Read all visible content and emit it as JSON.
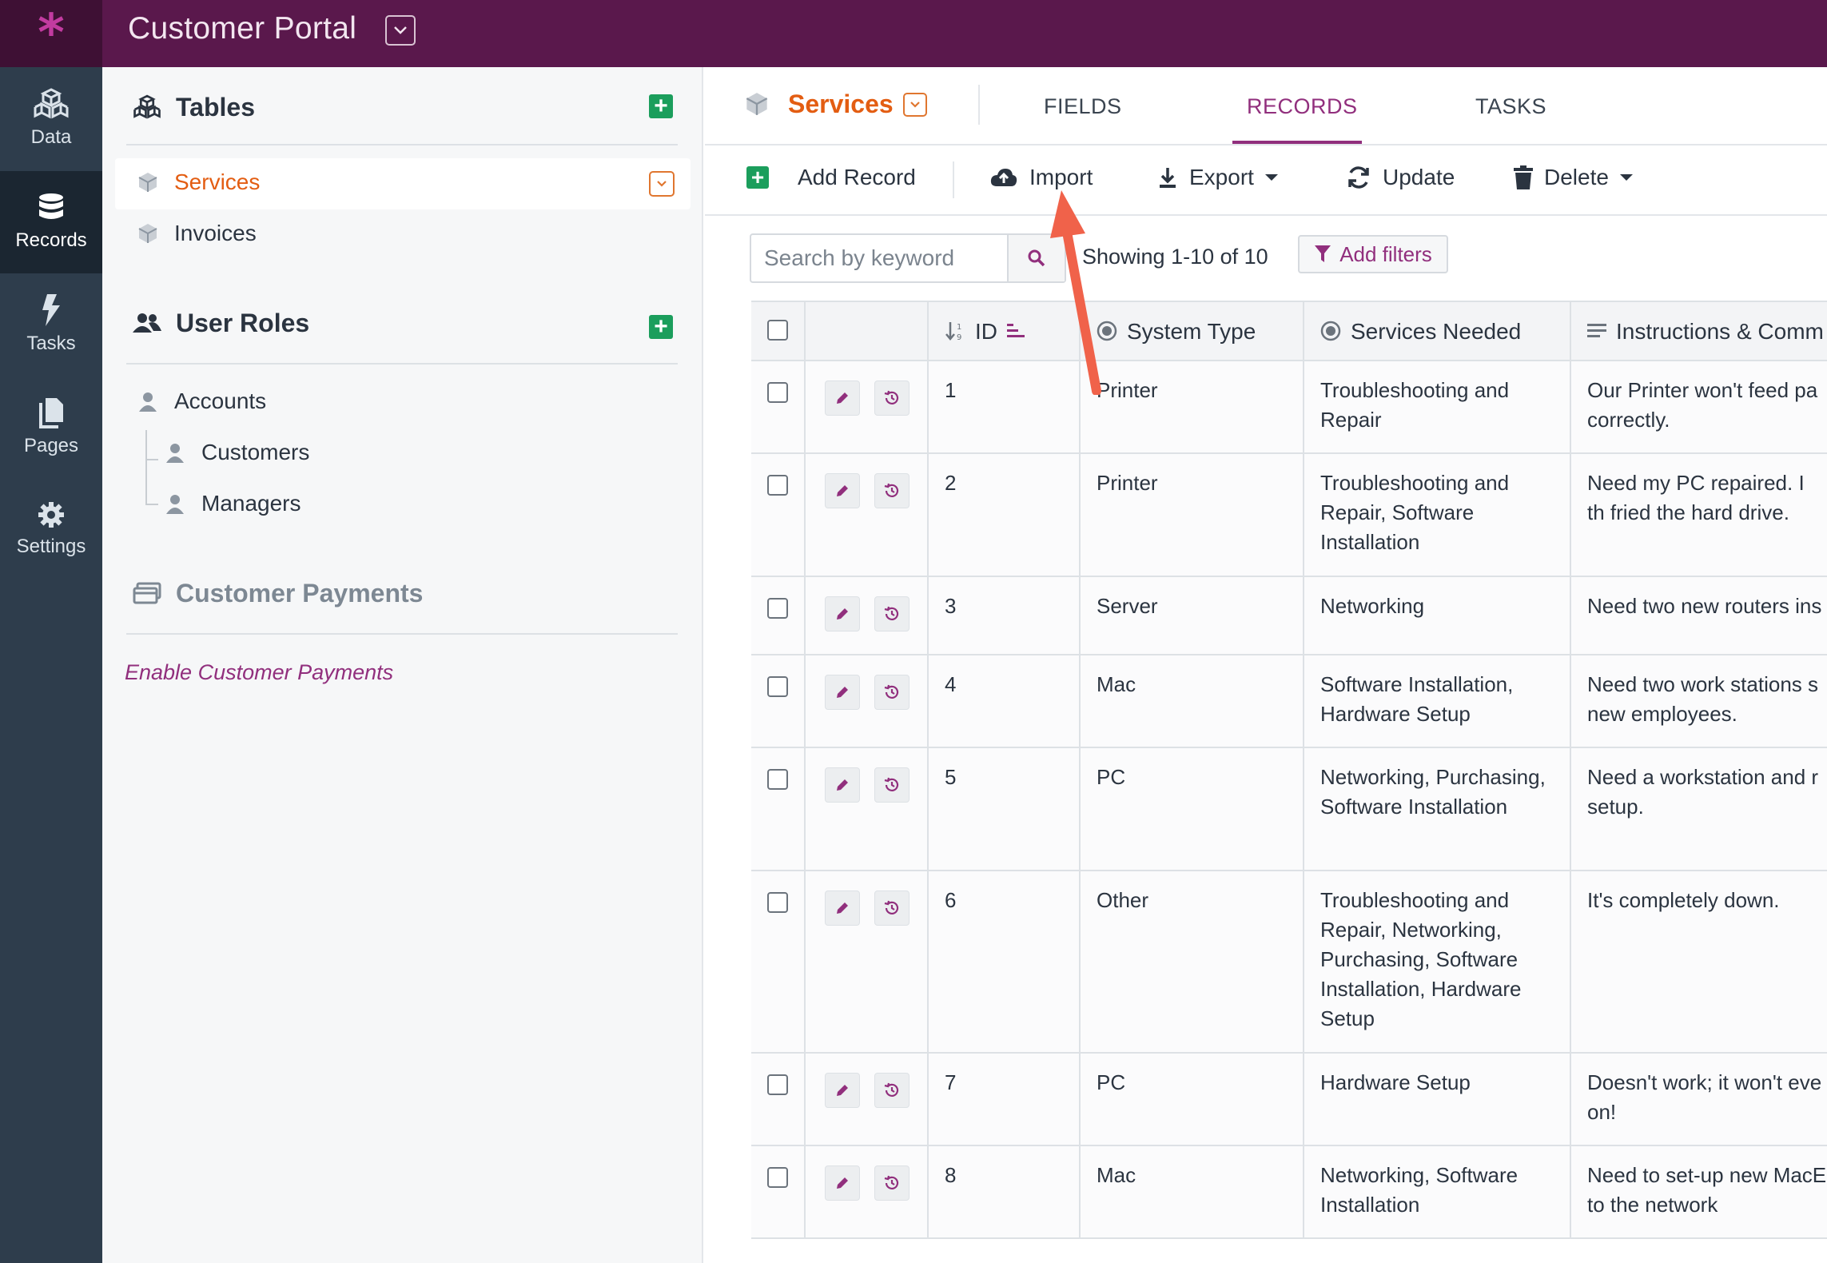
{
  "app": {
    "logo_glyph": "*",
    "title": "Customer Portal"
  },
  "leftnav": [
    {
      "label": "Data",
      "icon": "cubes-icon"
    },
    {
      "label": "Records",
      "icon": "database-icon",
      "active": true
    },
    {
      "label": "Tasks",
      "icon": "bolt-icon"
    },
    {
      "label": "Pages",
      "icon": "pages-icon"
    },
    {
      "label": "Settings",
      "icon": "gear-icon"
    }
  ],
  "sidebar": {
    "tables_title": "Tables",
    "tables": [
      {
        "label": "Services",
        "selected": true
      },
      {
        "label": "Invoices"
      }
    ],
    "roles_title": "User Roles",
    "roles": [
      {
        "label": "Accounts"
      },
      {
        "label": "Customers"
      },
      {
        "label": "Managers"
      }
    ],
    "payments_title": "Customer Payments",
    "payments_link": "Enable Customer Payments"
  },
  "main": {
    "object_name": "Services",
    "tabs": [
      "FIELDS",
      "RECORDS",
      "TASKS"
    ],
    "active_tab": "RECORDS",
    "toolbar": {
      "add_record": "Add Record",
      "import": "Import",
      "export": "Export",
      "update": "Update",
      "delete": "Delete"
    },
    "search": {
      "placeholder": "Search by keyword",
      "value": ""
    },
    "showing": "Showing 1-10 of 10",
    "add_filters": "Add filters",
    "columns": [
      "ID",
      "System Type",
      "Services Needed",
      "Instructions & Comm"
    ],
    "rows": [
      {
        "id": "1",
        "system": "Printer",
        "services": "Troubleshooting and Repair",
        "instructions": "Our Printer won't feed pa correctly."
      },
      {
        "id": "2",
        "system": "Printer",
        "services": "Troubleshooting and Repair, Software Installation",
        "instructions": "Need my PC repaired. I th fried the hard drive."
      },
      {
        "id": "3",
        "system": "Server",
        "services": "Networking",
        "instructions": "Need two new routers ins"
      },
      {
        "id": "4",
        "system": "Mac",
        "services": "Software Installation, Hardware Setup",
        "instructions": "Need two work stations s new employees."
      },
      {
        "id": "5",
        "system": "PC",
        "services": "Networking, Purchasing, Software Installation",
        "instructions": "Need a workstation and r setup."
      },
      {
        "id": "6",
        "system": "Other",
        "services": "Troubleshooting and Repair, Networking, Purchasing, Software Installation, Hardware Setup",
        "instructions": "It's completely down."
      },
      {
        "id": "7",
        "system": "PC",
        "services": "Hardware Setup",
        "instructions": "Doesn't work; it won't eve on!"
      },
      {
        "id": "8",
        "system": "Mac",
        "services": "Networking, Software Installation",
        "instructions": "Need to set-up new MacE to the network"
      }
    ]
  },
  "colors": {
    "topbar": "#5a184c",
    "accent": "#912f7d",
    "orange": "#e35d12",
    "green": "#1b9e5c",
    "annotation_arrow": "#f0624a"
  }
}
